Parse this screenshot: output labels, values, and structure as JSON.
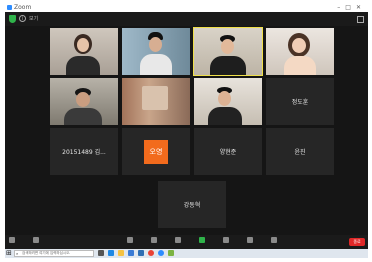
{
  "window": {
    "title": "Zoom"
  },
  "topbar": {
    "view_label": "보기"
  },
  "participants": [
    {
      "name": "",
      "kind": "video"
    },
    {
      "name": "",
      "kind": "video"
    },
    {
      "name": "",
      "kind": "video",
      "active": true
    },
    {
      "name": "",
      "kind": "video"
    },
    {
      "name": "",
      "kind": "video"
    },
    {
      "name": "",
      "kind": "video"
    },
    {
      "name": "",
      "kind": "video"
    },
    {
      "name": "정도훈",
      "kind": "name"
    },
    {
      "name": "20151489 김...",
      "kind": "name"
    },
    {
      "name": "오영",
      "kind": "avatar",
      "avatar_color": "#f26b1d"
    },
    {
      "name": "양현준",
      "kind": "name"
    },
    {
      "name": "윤진",
      "kind": "name"
    },
    {
      "name": "강동혁",
      "kind": "name"
    }
  ],
  "toolbar": {
    "end_label": "종료"
  },
  "taskbar": {
    "search_placeholder": "검색하려면 여기에 입력하십시오.",
    "clock": ""
  },
  "colors": {
    "accent": "#2d8cff",
    "end": "#e02828",
    "active_speaker": "#f0e04a"
  }
}
